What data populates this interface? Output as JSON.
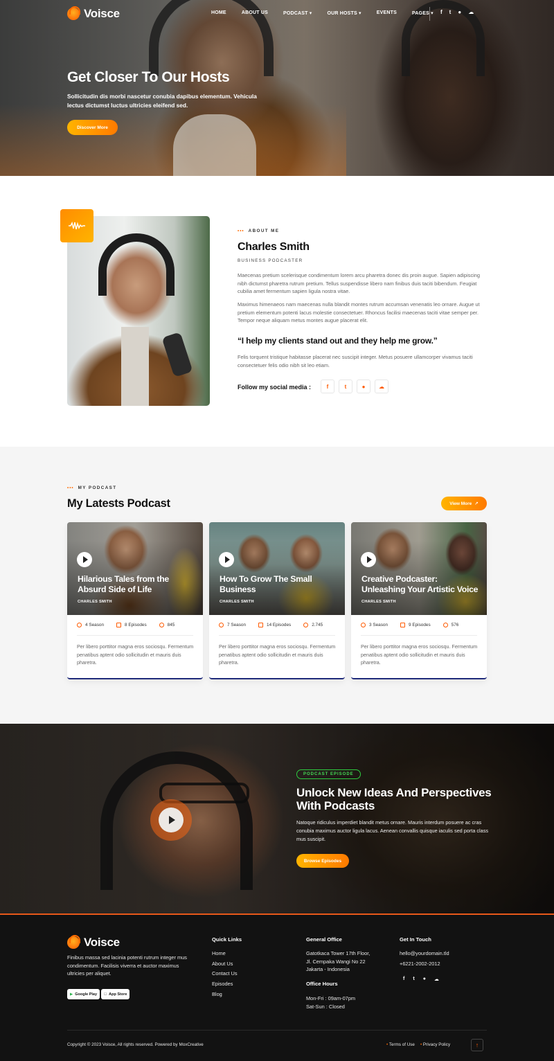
{
  "brand": {
    "name": "Voisce",
    "accent": "#ff7a00",
    "accent_light": "#ffb400"
  },
  "nav": {
    "items": [
      "HOME",
      "ABOUT US",
      "PODCAST",
      "OUR HOSTS",
      "EVENTS",
      "PAGES"
    ],
    "social_icons": [
      "facebook-icon",
      "twitter-icon",
      "spotify-icon",
      "soundcloud-icon"
    ]
  },
  "hero": {
    "title": "Get Closer To Our Hosts",
    "subtitle": "Sollicitudin dis morbi nascetur conubia dapibus elementum. Vehicula lectus dictumst luctus ultricies eleifend sed.",
    "button": "Discover More"
  },
  "about": {
    "eyebrow": "ABOUT ME",
    "name": "Charles Smith",
    "role": "BUSINESS PODCASTER",
    "para1": "Maecenas pretium scelerisque condimentum lorem arcu pharetra donec dis proin augue. Sapien adipiscing nibh dictumst pharetra rutrum pretium. Tellus suspendisse libero nam finibus duis taciti bibendum. Feugiat cubilia amet fermentum sapien ligula nostra vitae.",
    "para2": "Maximus himenaeos nam maecenas nulla blandit montes rutrum accumsan venenatis leo ornare. Augue ut pretium elementum potenti lacus molestie consectetuer. Rhoncus facilisi maecenas taciti vitae semper per. Tempor neque aliquam metus montes augue placerat elit.",
    "quote": "“I help my clients stand out and they help me grow.”",
    "para3": "Felis torquent tristique habitasse placerat nec suscipit integer. Metus posuere ullamcorper vivamus taciti consectetuer felis odio nibh sit leo etiam.",
    "social_label": "Follow my social media :"
  },
  "podcast": {
    "eyebrow": "MY PODCAST",
    "title": "My Latests Podcast",
    "view_more": "View More",
    "cards": [
      {
        "title": "Hilarious Tales from the Absurd Side of Life",
        "host": "CHARLES SMITH",
        "season": "4 Season",
        "episodes": "8 Episodes",
        "listens": "845",
        "text": "Per libero porttitor magna eros sociosqu. Fermentum penatibus aptent odio sollicitudin et mauris duis pharetra."
      },
      {
        "title": "How To Grow The Small Business",
        "host": "CHARLES SMITH",
        "season": "7 Season",
        "episodes": "14 Episodes",
        "listens": "2.745",
        "text": "Per libero porttitor magna eros sociosqu. Fermentum penatibus aptent odio sollicitudin et mauris duis pharetra."
      },
      {
        "title": "Creative Podcaster: Unleashing Your Artistic Voice",
        "host": "CHARLES SMITH",
        "season": "3 Season",
        "episodes": "9 Episodes",
        "listens": "576",
        "text": "Per libero porttitor magna eros sociosqu. Fermentum penatibus aptent odio sollicitudin et mauris duis pharetra."
      }
    ]
  },
  "episode": {
    "tag": "PODCAST EPISODE",
    "title": "Unlock New Ideas And Perspectives With Podcasts",
    "text": "Natoque ridiculus imperdiet blandit metus ornare. Mauris interdum posuere ac cras conubia maximus auctor ligula lacus. Aenean convallis quisque iaculis sed porta class mus suscipit.",
    "button": "Browse Episodes"
  },
  "footer": {
    "about": "Finibus massa sed lacinia potenti rutrum integer mus condimentum. Facilisis viverra et auctor maximus ultricies per aliquet.",
    "google_play": "Google Play",
    "app_store": "App Store",
    "quick_links_title": "Quick Links",
    "quick_links": [
      "Home",
      "About Us",
      "Contact Us",
      "Episodes",
      "Blog"
    ],
    "office_title": "General Office",
    "office_address": [
      "Gatotkaca Tower 17th Floor,",
      "Jl. Cempaka Wangi No 22",
      "Jakarta - Indonesia"
    ],
    "hours_title": "Office Hours",
    "hours": [
      "Mon-Fri : 09am-07pm",
      "Sat-Sun : Closed"
    ],
    "contact_title": "Get In Touch",
    "email": "hello@yourdomain.tld",
    "phone": "+6221-2002-2012",
    "copyright": "Copyright © 2023 Voisce, All rights reserved. Powered by MoxCreative",
    "terms": "Terms of Use",
    "privacy": "Privacy Policy"
  }
}
